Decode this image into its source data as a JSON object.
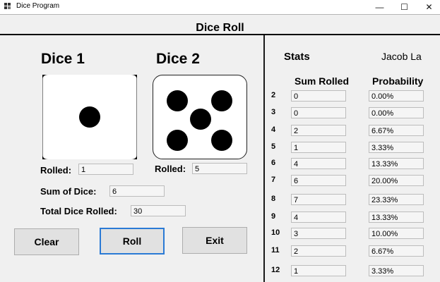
{
  "window": {
    "title": "Dice Program",
    "minimize_glyph": "—",
    "maximize_glyph": "☐",
    "close_glyph": "✕"
  },
  "header": {
    "title": "Dice Roll"
  },
  "dice": {
    "dice1_label": "Dice 1",
    "dice2_label": "Dice 2",
    "dice1_value": 1,
    "dice2_value": 5,
    "rolled_label": "Rolled:",
    "rolled1": "1",
    "rolled2": "5"
  },
  "summary": {
    "sum_label": "Sum of Dice:",
    "sum_value": "6",
    "total_label": "Total Dice Rolled:",
    "total_value": "30"
  },
  "buttons": {
    "clear": "Clear",
    "roll": "Roll",
    "exit": "Exit"
  },
  "stats": {
    "title": "Stats",
    "author": "Jacob La",
    "col_sum": "Sum Rolled",
    "col_prob": "Probability",
    "rows": [
      {
        "sum": "2",
        "count": "0",
        "prob": "0.00%"
      },
      {
        "sum": "3",
        "count": "0",
        "prob": "0.00%"
      },
      {
        "sum": "4",
        "count": "2",
        "prob": "6.67%"
      },
      {
        "sum": "5",
        "count": "1",
        "prob": "3.33%"
      },
      {
        "sum": "6",
        "count": "4",
        "prob": "13.33%"
      },
      {
        "sum": "7",
        "count": "6",
        "prob": "20.00%"
      },
      {
        "sum": "8",
        "count": "7",
        "prob": "23.33%"
      },
      {
        "sum": "9",
        "count": "4",
        "prob": "13.33%"
      },
      {
        "sum": "10",
        "count": "3",
        "prob": "10.00%"
      },
      {
        "sum": "11",
        "count": "2",
        "prob": "6.67%"
      },
      {
        "sum": "12",
        "count": "1",
        "prob": "3.33%"
      }
    ]
  }
}
